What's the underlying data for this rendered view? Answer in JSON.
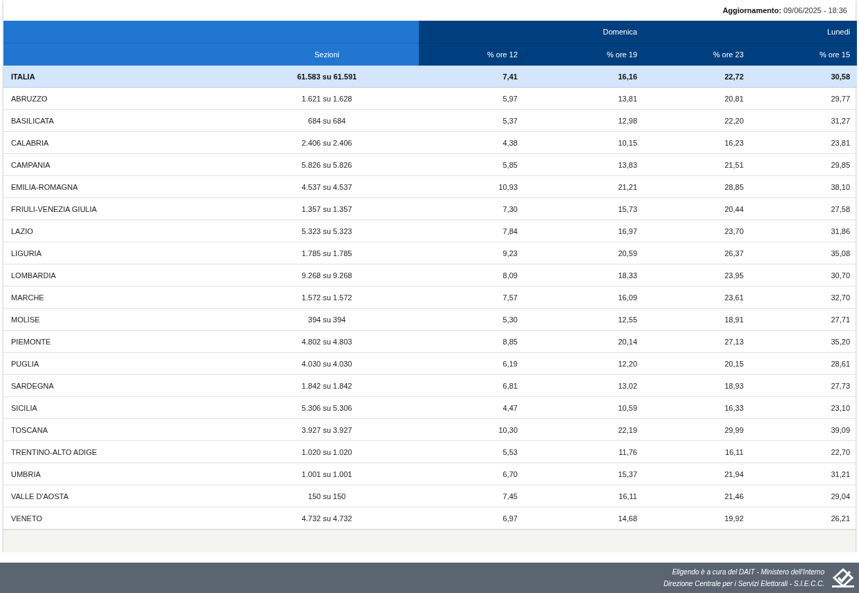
{
  "update": {
    "label": "Aggiornamento:",
    "value": "09/06/2025 - 18:36"
  },
  "table": {
    "groups": [
      {
        "label": "Domenica"
      },
      {
        "label": "Lunedi"
      }
    ],
    "columns": [
      "Sezioni",
      "% ore 12",
      "% ore 19",
      "% ore 23",
      "% ore 15"
    ],
    "total": {
      "name": "ITALIA",
      "sections": "61.583 su 61.591",
      "values": [
        "7,41",
        "16,16",
        "22,72",
        "30,58"
      ]
    },
    "rows": [
      {
        "name": "ABRUZZO",
        "sections": "1.621 su 1.628",
        "values": [
          "5,97",
          "13,81",
          "20,81",
          "29,77"
        ]
      },
      {
        "name": "BASILICATA",
        "sections": "684 su 684",
        "values": [
          "5,37",
          "12,98",
          "22,20",
          "31,27"
        ]
      },
      {
        "name": "CALABRIA",
        "sections": "2.406 su 2.406",
        "values": [
          "4,38",
          "10,15",
          "16,23",
          "23,81"
        ]
      },
      {
        "name": "CAMPANIA",
        "sections": "5.826 su 5.826",
        "values": [
          "5,85",
          "13,83",
          "21,51",
          "29,85"
        ]
      },
      {
        "name": "EMILIA-ROMAGNA",
        "sections": "4.537 su 4.537",
        "values": [
          "10,93",
          "21,21",
          "28,85",
          "38,10"
        ]
      },
      {
        "name": "FRIULI-VENEZIA GIULIA",
        "sections": "1.357 su 1.357",
        "values": [
          "7,30",
          "15,73",
          "20,44",
          "27,58"
        ]
      },
      {
        "name": "LAZIO",
        "sections": "5.323 su 5.323",
        "values": [
          "7,84",
          "16,97",
          "23,70",
          "31,86"
        ]
      },
      {
        "name": "LIGURIA",
        "sections": "1.785 su 1.785",
        "values": [
          "9,23",
          "20,59",
          "26,37",
          "35,08"
        ]
      },
      {
        "name": "LOMBARDIA",
        "sections": "9.268 su 9.268",
        "values": [
          "8,09",
          "18,33",
          "23,95",
          "30,70"
        ]
      },
      {
        "name": "MARCHE",
        "sections": "1.572 su 1.572",
        "values": [
          "7,57",
          "16,09",
          "23,61",
          "32,70"
        ]
      },
      {
        "name": "MOLISE",
        "sections": "394 su 394",
        "values": [
          "5,30",
          "12,55",
          "18,91",
          "27,71"
        ]
      },
      {
        "name": "PIEMONTE",
        "sections": "4.802 su 4.803",
        "values": [
          "8,85",
          "20,14",
          "27,13",
          "35,20"
        ]
      },
      {
        "name": "PUGLIA",
        "sections": "4.030 su 4.030",
        "values": [
          "6,19",
          "12,20",
          "20,15",
          "28,61"
        ]
      },
      {
        "name": "SARDEGNA",
        "sections": "1.842 su 1.842",
        "values": [
          "6,81",
          "13,02",
          "18,93",
          "27,73"
        ]
      },
      {
        "name": "SICILIA",
        "sections": "5.306 su 5.306",
        "values": [
          "4,47",
          "10,59",
          "16,33",
          "23,10"
        ]
      },
      {
        "name": "TOSCANA",
        "sections": "3.927 su 3.927",
        "values": [
          "10,30",
          "22,19",
          "29,99",
          "39,09"
        ]
      },
      {
        "name": "TRENTINO-ALTO ADIGE",
        "sections": "1.020 su 1.020",
        "values": [
          "5,53",
          "11,76",
          "16,11",
          "22,70"
        ]
      },
      {
        "name": "UMBRIA",
        "sections": "1.001 su 1.001",
        "values": [
          "6,70",
          "15,37",
          "21,94",
          "31,21"
        ]
      },
      {
        "name": "VALLE D'AOSTA",
        "sections": "150 su 150",
        "values": [
          "7,45",
          "16,11",
          "21,46",
          "29,04"
        ]
      },
      {
        "name": "VENETO",
        "sections": "4.732 su 4.732",
        "values": [
          "6,97",
          "14,68",
          "19,92",
          "26,21"
        ]
      }
    ]
  },
  "footer": {
    "lines": [
      "Eligendo è a cura del DAIT - Ministero dell'Interno",
      "Direzione Centrale per i Servizi Elettorali - S.I.E.C.C."
    ]
  }
}
